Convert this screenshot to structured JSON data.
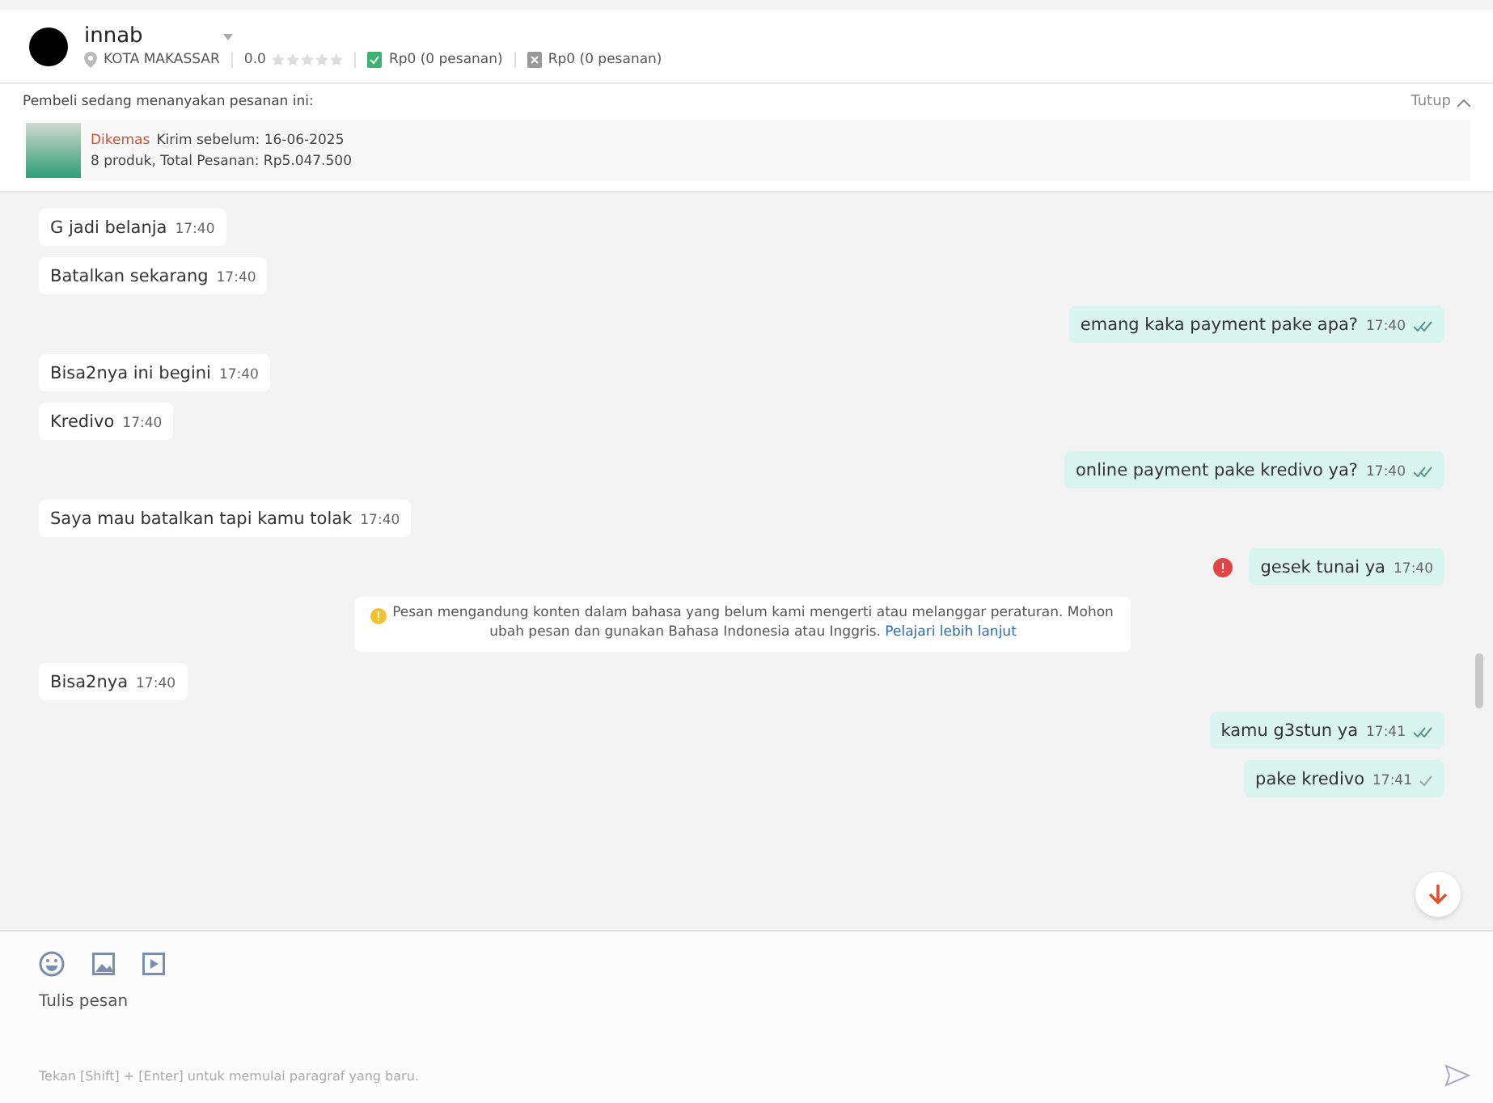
{
  "header": {
    "name": "innab",
    "location": "KOTA MAKASSAR",
    "rating": "0.0",
    "stars": 0,
    "stat_1": "Rp0 (0 pesanan)",
    "stat_2": "Rp0 (0 pesanan)"
  },
  "inquiry": {
    "title": "Pembeli sedang menanyakan pesanan ini:",
    "close": "Tutup",
    "status": "Dikemas",
    "deadline": "Kirim sebelum: 16-06-2025",
    "summary": "8 produk, Total Pesanan: Rp5.047.500"
  },
  "messages": [
    {
      "kind": "in",
      "text": "G jadi belanja",
      "time": "17:40"
    },
    {
      "kind": "in",
      "text": "Batalkan sekarang",
      "time": "17:40"
    },
    {
      "kind": "out",
      "text": "emang kaka payment pake apa?",
      "time": "17:40",
      "read": true,
      "failed": false
    },
    {
      "kind": "in",
      "text": "Bisa2nya ini begini",
      "time": "17:40"
    },
    {
      "kind": "in",
      "text": "Kredivo",
      "time": "17:40"
    },
    {
      "kind": "out",
      "text": "online payment pake kredivo ya?",
      "time": "17:40",
      "read": true,
      "failed": false
    },
    {
      "kind": "in",
      "text": "Saya mau batalkan tapi kamu tolak",
      "time": "17:40"
    },
    {
      "kind": "out",
      "text": "gesek tunai ya",
      "time": "17:40",
      "failed": true
    },
    {
      "kind": "notice",
      "text": "Pesan mengandung konten dalam bahasa yang belum kami mengerti atau melanggar peraturan. Mohon ubah pesan dan gunakan Bahasa Indonesia atau Inggris.",
      "link": "Pelajari lebih lanjut"
    },
    {
      "kind": "in",
      "text": "Bisa2nya",
      "time": "17:40"
    },
    {
      "kind": "out",
      "text": "kamu g3stun ya",
      "time": "17:41",
      "read": true,
      "failed": false
    },
    {
      "kind": "out",
      "text": "pake kredivo",
      "time": "17:41",
      "read": false,
      "failed": false
    }
  ],
  "composer": {
    "placeholder": "Tulis pesan",
    "hint": "Tekan [Shift] + [Enter] untuk memulai paragraf yang baru."
  }
}
